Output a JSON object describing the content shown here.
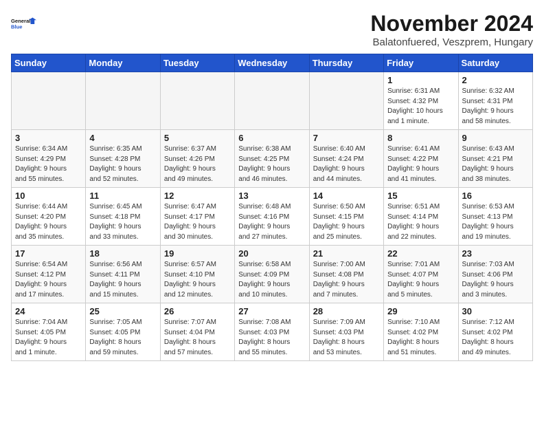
{
  "logo": {
    "line1": "General",
    "line2": "Blue"
  },
  "title": "November 2024",
  "location": "Balatonfuered, Veszprem, Hungary",
  "weekdays": [
    "Sunday",
    "Monday",
    "Tuesday",
    "Wednesday",
    "Thursday",
    "Friday",
    "Saturday"
  ],
  "weeks": [
    [
      {
        "day": "",
        "info": ""
      },
      {
        "day": "",
        "info": ""
      },
      {
        "day": "",
        "info": ""
      },
      {
        "day": "",
        "info": ""
      },
      {
        "day": "",
        "info": ""
      },
      {
        "day": "1",
        "info": "Sunrise: 6:31 AM\nSunset: 4:32 PM\nDaylight: 10 hours\nand 1 minute."
      },
      {
        "day": "2",
        "info": "Sunrise: 6:32 AM\nSunset: 4:31 PM\nDaylight: 9 hours\nand 58 minutes."
      }
    ],
    [
      {
        "day": "3",
        "info": "Sunrise: 6:34 AM\nSunset: 4:29 PM\nDaylight: 9 hours\nand 55 minutes."
      },
      {
        "day": "4",
        "info": "Sunrise: 6:35 AM\nSunset: 4:28 PM\nDaylight: 9 hours\nand 52 minutes."
      },
      {
        "day": "5",
        "info": "Sunrise: 6:37 AM\nSunset: 4:26 PM\nDaylight: 9 hours\nand 49 minutes."
      },
      {
        "day": "6",
        "info": "Sunrise: 6:38 AM\nSunset: 4:25 PM\nDaylight: 9 hours\nand 46 minutes."
      },
      {
        "day": "7",
        "info": "Sunrise: 6:40 AM\nSunset: 4:24 PM\nDaylight: 9 hours\nand 44 minutes."
      },
      {
        "day": "8",
        "info": "Sunrise: 6:41 AM\nSunset: 4:22 PM\nDaylight: 9 hours\nand 41 minutes."
      },
      {
        "day": "9",
        "info": "Sunrise: 6:43 AM\nSunset: 4:21 PM\nDaylight: 9 hours\nand 38 minutes."
      }
    ],
    [
      {
        "day": "10",
        "info": "Sunrise: 6:44 AM\nSunset: 4:20 PM\nDaylight: 9 hours\nand 35 minutes."
      },
      {
        "day": "11",
        "info": "Sunrise: 6:45 AM\nSunset: 4:18 PM\nDaylight: 9 hours\nand 33 minutes."
      },
      {
        "day": "12",
        "info": "Sunrise: 6:47 AM\nSunset: 4:17 PM\nDaylight: 9 hours\nand 30 minutes."
      },
      {
        "day": "13",
        "info": "Sunrise: 6:48 AM\nSunset: 4:16 PM\nDaylight: 9 hours\nand 27 minutes."
      },
      {
        "day": "14",
        "info": "Sunrise: 6:50 AM\nSunset: 4:15 PM\nDaylight: 9 hours\nand 25 minutes."
      },
      {
        "day": "15",
        "info": "Sunrise: 6:51 AM\nSunset: 4:14 PM\nDaylight: 9 hours\nand 22 minutes."
      },
      {
        "day": "16",
        "info": "Sunrise: 6:53 AM\nSunset: 4:13 PM\nDaylight: 9 hours\nand 19 minutes."
      }
    ],
    [
      {
        "day": "17",
        "info": "Sunrise: 6:54 AM\nSunset: 4:12 PM\nDaylight: 9 hours\nand 17 minutes."
      },
      {
        "day": "18",
        "info": "Sunrise: 6:56 AM\nSunset: 4:11 PM\nDaylight: 9 hours\nand 15 minutes."
      },
      {
        "day": "19",
        "info": "Sunrise: 6:57 AM\nSunset: 4:10 PM\nDaylight: 9 hours\nand 12 minutes."
      },
      {
        "day": "20",
        "info": "Sunrise: 6:58 AM\nSunset: 4:09 PM\nDaylight: 9 hours\nand 10 minutes."
      },
      {
        "day": "21",
        "info": "Sunrise: 7:00 AM\nSunset: 4:08 PM\nDaylight: 9 hours\nand 7 minutes."
      },
      {
        "day": "22",
        "info": "Sunrise: 7:01 AM\nSunset: 4:07 PM\nDaylight: 9 hours\nand 5 minutes."
      },
      {
        "day": "23",
        "info": "Sunrise: 7:03 AM\nSunset: 4:06 PM\nDaylight: 9 hours\nand 3 minutes."
      }
    ],
    [
      {
        "day": "24",
        "info": "Sunrise: 7:04 AM\nSunset: 4:05 PM\nDaylight: 9 hours\nand 1 minute."
      },
      {
        "day": "25",
        "info": "Sunrise: 7:05 AM\nSunset: 4:05 PM\nDaylight: 8 hours\nand 59 minutes."
      },
      {
        "day": "26",
        "info": "Sunrise: 7:07 AM\nSunset: 4:04 PM\nDaylight: 8 hours\nand 57 minutes."
      },
      {
        "day": "27",
        "info": "Sunrise: 7:08 AM\nSunset: 4:03 PM\nDaylight: 8 hours\nand 55 minutes."
      },
      {
        "day": "28",
        "info": "Sunrise: 7:09 AM\nSunset: 4:03 PM\nDaylight: 8 hours\nand 53 minutes."
      },
      {
        "day": "29",
        "info": "Sunrise: 7:10 AM\nSunset: 4:02 PM\nDaylight: 8 hours\nand 51 minutes."
      },
      {
        "day": "30",
        "info": "Sunrise: 7:12 AM\nSunset: 4:02 PM\nDaylight: 8 hours\nand 49 minutes."
      }
    ]
  ]
}
